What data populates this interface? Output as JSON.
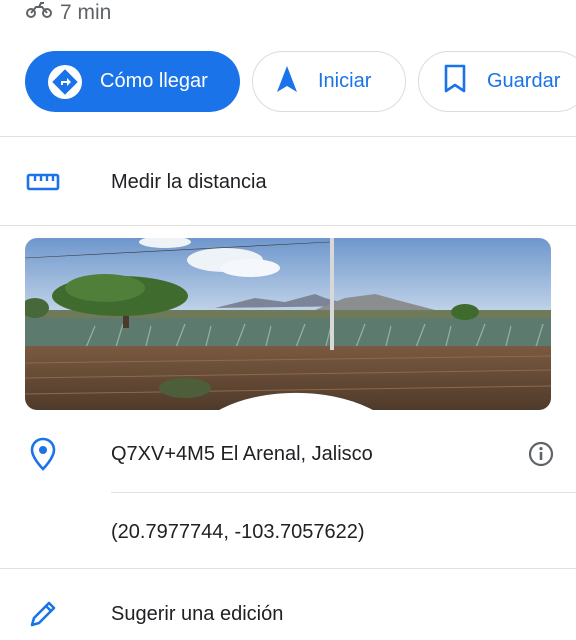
{
  "eta": {
    "icon": "motorcycle-icon",
    "text": "7 min"
  },
  "actions": {
    "directions": {
      "label": "Cómo llegar",
      "icon": "directions-icon"
    },
    "start": {
      "label": "Iniciar",
      "icon": "navigation-arrow-icon"
    },
    "save": {
      "label": "Guardar",
      "icon": "bookmark-icon"
    }
  },
  "measure": {
    "label": "Medir la distancia",
    "icon": "ruler-icon"
  },
  "photo": {
    "type": "street-view-thumbnail",
    "icon": "street-view-360-icon"
  },
  "location": {
    "plus_code": "Q7XV+4M5 El Arenal, Jalisco",
    "icon": "location-pin-icon",
    "info_icon": "info-icon",
    "coordinates": "(20.7977744, -103.7057622)"
  },
  "suggest_edit": {
    "label": "Sugerir una edición",
    "icon": "pencil-icon"
  },
  "colors": {
    "accent": "#1a73e8",
    "text": "#202124",
    "secondary": "#5f6368",
    "divider": "#e0e0e0"
  }
}
